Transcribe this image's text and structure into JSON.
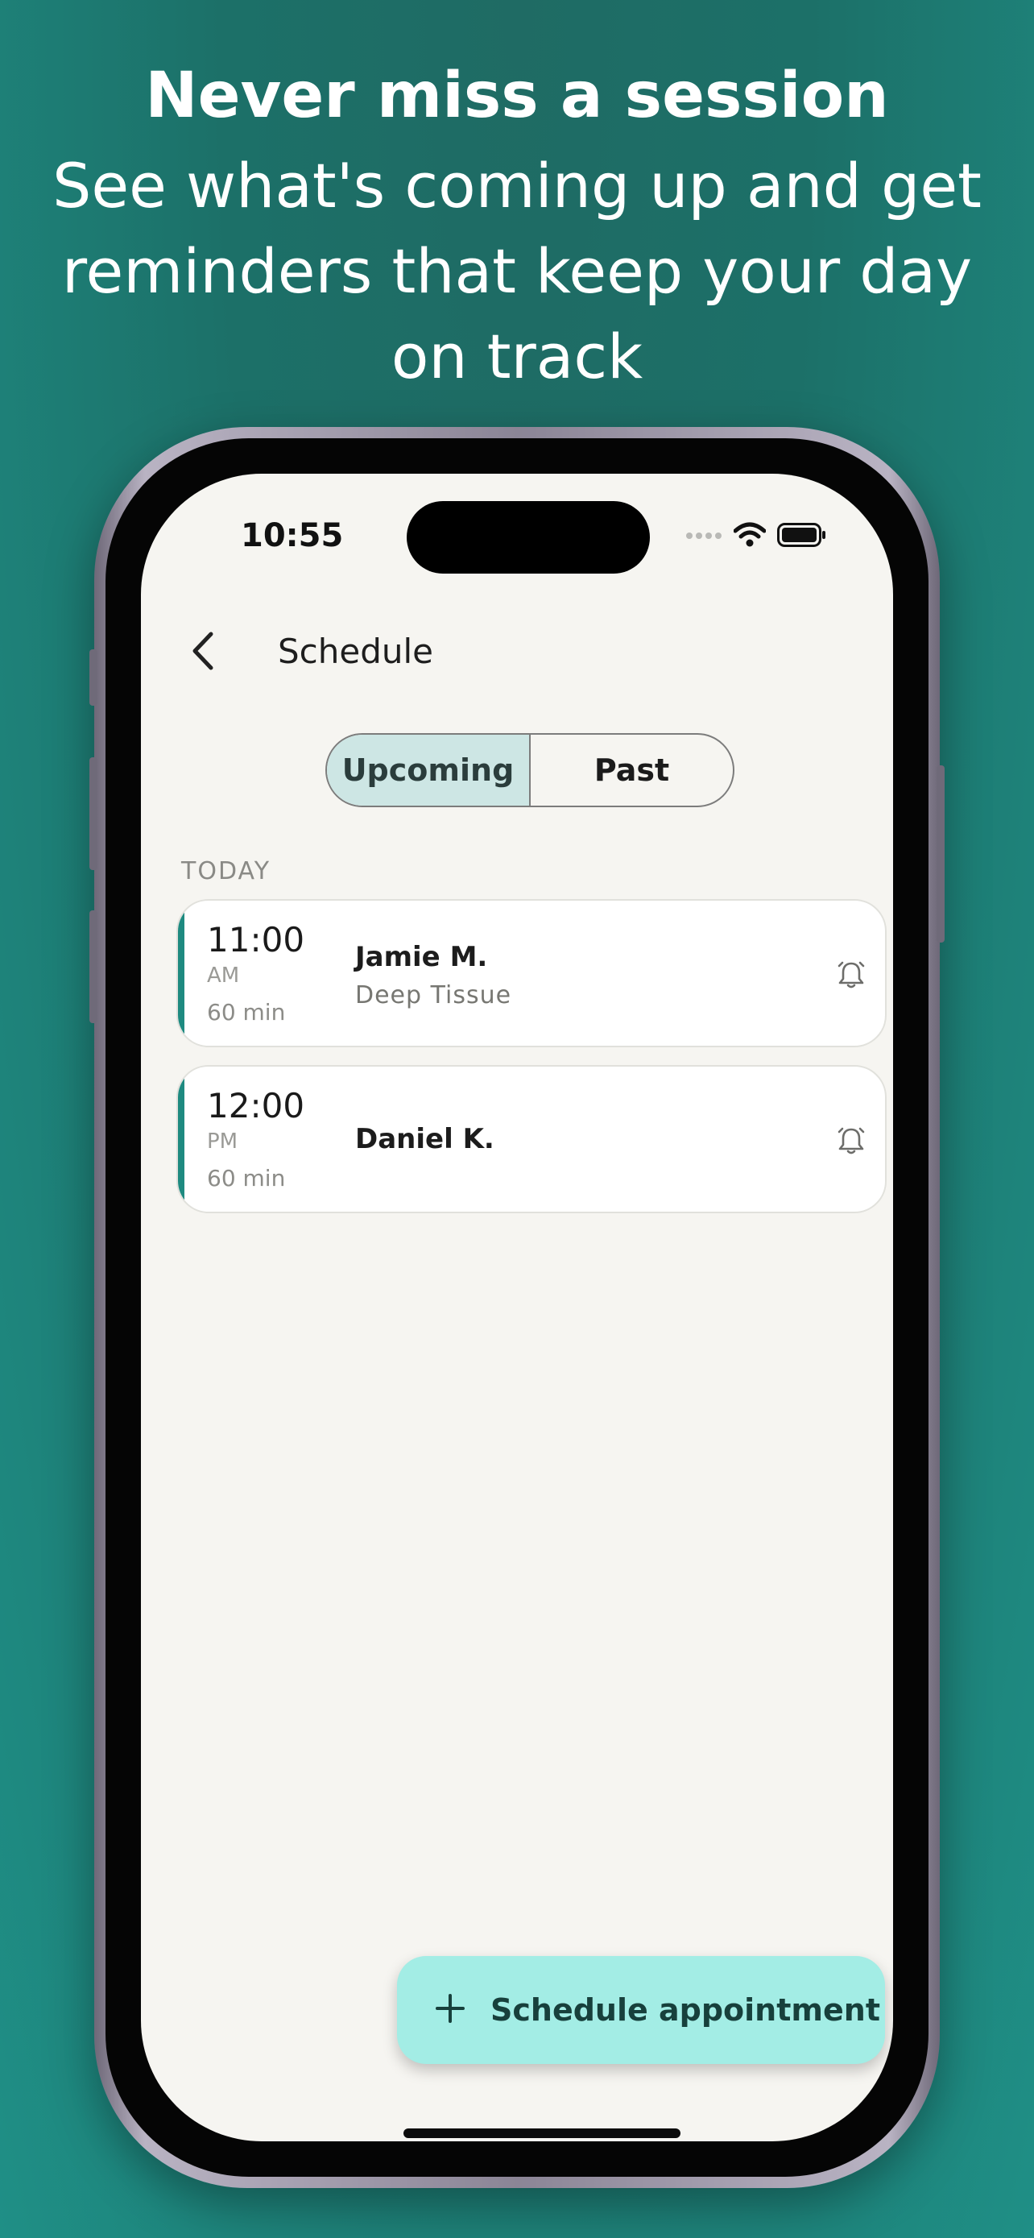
{
  "promo": {
    "title": "Never miss a session",
    "subtitle": "See what's coming up and get reminders that keep your day on track"
  },
  "status_bar": {
    "time": "10:55",
    "icons": [
      "signal-dots-icon",
      "wifi-icon",
      "battery-icon"
    ]
  },
  "nav": {
    "back_icon": "chevron-left-icon",
    "title": "Schedule"
  },
  "tabs": [
    {
      "label": "Upcoming",
      "selected": true
    },
    {
      "label": "Past",
      "selected": false
    }
  ],
  "section": {
    "label": "TODAY"
  },
  "appointments": [
    {
      "time": "11:00",
      "ampm": "AM",
      "duration": "60 min",
      "client": "Jamie M.",
      "service": "Deep Tissue",
      "reminder_icon": "bell-icon"
    },
    {
      "time": "12:00",
      "ampm": "PM",
      "duration": "60 min",
      "client": "Daniel K.",
      "service": "",
      "reminder_icon": "bell-icon"
    }
  ],
  "fab": {
    "icon": "plus-icon",
    "label": "Schedule appointment"
  },
  "colors": {
    "background": "#1c7068",
    "accent": "#1e8a80",
    "tab_selected": "#cde6e4",
    "fab": "#a3ede5",
    "screen": "#f6f5f1"
  }
}
